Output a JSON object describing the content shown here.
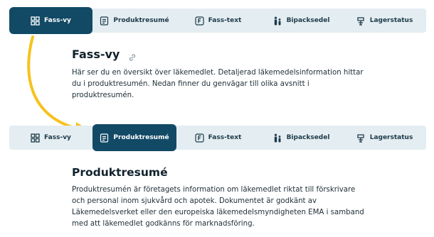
{
  "colors": {
    "tab_bar_bg": "#e4edf1",
    "active_tab_bg": "#124a66",
    "active_tab_text": "#ffffff",
    "arrow": "#f6c21d"
  },
  "top_tabs": {
    "active": "Fass-vy",
    "items": [
      {
        "label": "Fass-vy",
        "icon": "grid-icon"
      },
      {
        "label": "Produktresumé",
        "icon": "document-icon"
      },
      {
        "label": "Fass-text",
        "icon": "f-box-icon"
      },
      {
        "label": "Bipacksedel",
        "icon": "family-icon"
      },
      {
        "label": "Lagerstatus",
        "icon": "pharmacy-icon"
      }
    ]
  },
  "bottom_tabs": {
    "active": "Produktresumé",
    "items": [
      {
        "label": "Fass-vy",
        "icon": "grid-icon"
      },
      {
        "label": "Produktresumé",
        "icon": "document-icon"
      },
      {
        "label": "Fass-text",
        "icon": "f-box-icon"
      },
      {
        "label": "Bipacksedel",
        "icon": "family-icon"
      },
      {
        "label": "Lagerstatus",
        "icon": "pharmacy-icon"
      }
    ]
  },
  "section1": {
    "title": "Fass-vy",
    "lines": [
      "Här ser du en översikt över läkemedlet. Detaljerad läkemedelsinformation hittar",
      "du i produktresumén. Nedan finner du genvägar till olika avsnitt i",
      "produktresumén."
    ]
  },
  "section2": {
    "title": "Produktresumé",
    "lines": [
      "Produktresumén är företagets information om läkemedlet riktat till förskrivare",
      "och personal inom sjukvård och apotek. Dokumentet är godkänt av",
      "Läkemedelsverket eller den europeiska läkemedelsmyndigheten EMA i samband",
      "med att läkemedlet godkänns för marknadsföring."
    ]
  }
}
